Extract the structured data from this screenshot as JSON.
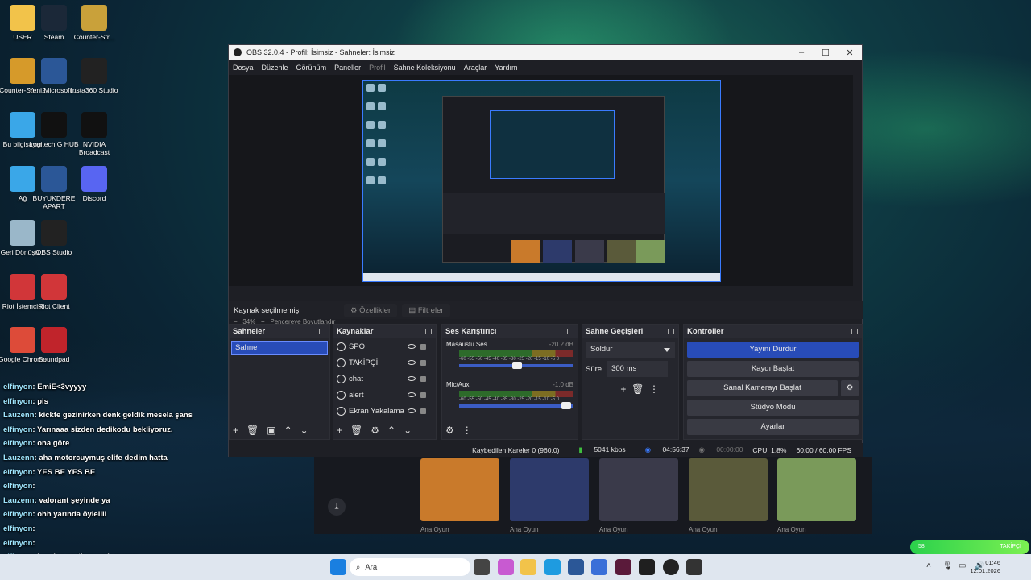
{
  "desktop_icons": [
    {
      "label": "USER",
      "icon": "folder-icon",
      "color": "#f2c34a"
    },
    {
      "label": "Steam",
      "icon": "steam-icon",
      "color": "#1b2838"
    },
    {
      "label": "Counter-Str...",
      "icon": "counter-strike-icon",
      "color": "#c9a13a"
    },
    {
      "label": "Counter-Str... 2",
      "icon": "counter-strike-icon",
      "color": "#d69a2a"
    },
    {
      "label": "Yeni Microsoft ...",
      "icon": "word-icon",
      "color": "#2b5797"
    },
    {
      "label": "Insta360 Studio",
      "icon": "insta360-icon",
      "color": "#222222"
    },
    {
      "label": "Bu bilgisayar",
      "icon": "computer-icon",
      "color": "#3aa7e8"
    },
    {
      "label": "Logitech G HUB",
      "icon": "logitech-icon",
      "color": "#111111"
    },
    {
      "label": "NVIDIA Broadcast",
      "icon": "nvidia-icon",
      "color": "#111111"
    },
    {
      "label": "Ağ",
      "icon": "network-icon",
      "color": "#3aa7e8"
    },
    {
      "label": "BUYUKDERE APART",
      "icon": "word-icon",
      "color": "#2b5797"
    },
    {
      "label": "Discord",
      "icon": "discord-icon",
      "color": "#5865f2"
    },
    {
      "label": "Geri Dönüşü...",
      "icon": "recycle-bin-icon",
      "color": "#9ab7c9"
    },
    {
      "label": "OBS Studio",
      "icon": "obs-icon",
      "color": "#222222"
    },
    {
      "label": "Riot İstemcisi",
      "icon": "riot-icon",
      "color": "#d13639"
    },
    {
      "label": "Riot Client",
      "icon": "riot-icon",
      "color": "#d13639"
    },
    {
      "label": "Google Chrome",
      "icon": "chrome-icon",
      "color": "#dd4b39"
    },
    {
      "label": "Soundpad",
      "icon": "soundpad-icon",
      "color": "#c0242b"
    }
  ],
  "chat": [
    {
      "user": "elfinyon",
      "text": ": EmiE<3vyyyy"
    },
    {
      "user": "elfinyon",
      "text": ": pis"
    },
    {
      "user": "Lauzenn",
      "text": ": kickte gezinirken denk geldik mesela şans"
    },
    {
      "user": "elfinyon",
      "text": ": Yarınaaa sizden dedikodu bekliyoruz."
    },
    {
      "user": "elfinyon",
      "text": ": ona göre"
    },
    {
      "user": "Lauzenn",
      "text": ": aha motorcuymuş elife dedim hatta"
    },
    {
      "user": "elfinyon",
      "text": ": YES BE YES BE"
    },
    {
      "user": "elfinyon",
      "text": ":"
    },
    {
      "user": "Lauzenn",
      "text": ": valorant şeyinde ya"
    },
    {
      "user": "elfinyon",
      "text": ": ohh yarında öyleiiii"
    },
    {
      "user": "elfinyon",
      "text": ":"
    },
    {
      "user": "elfinyon",
      "text": ":"
    },
    {
      "user": "elfinyon",
      "text": ": benden mutlusu yok şuanın"
    }
  ],
  "obs": {
    "title": "OBS 32.0.4 - Profil: İsimsiz - Sahneler: İsimsiz",
    "menu": [
      "Dosya",
      "Düzenle",
      "Görünüm",
      "Paneller",
      "Profil",
      "Sahne Koleksiyonu",
      "Araçlar",
      "Yardım"
    ],
    "zoom": "34%",
    "zoom_label": "Pencereye Boyutlandır",
    "source_status": "Kaynak seçilmemiş",
    "properties_label": "Özellikler",
    "filters_label": "Filtreler",
    "scenes": {
      "title": "Sahneler",
      "items": [
        "Sahne"
      ]
    },
    "sources": {
      "title": "Kaynaklar",
      "items": [
        "SPO",
        "TAKİPÇİ",
        "chat",
        "alert",
        "Ekran Yakalama"
      ]
    },
    "mixer": {
      "title": "Ses Karıştırıcı",
      "channels": [
        {
          "name": "Masaüstü Ses",
          "db": "-20.2 dB",
          "level": 0.55
        },
        {
          "name": "Mic/Aux",
          "db": "-1.0 dB",
          "level": 0.98
        }
      ],
      "ticks": "-60 -55 -50 -45 -40 -35 -30 -25 -20 -15 -10 -5 0"
    },
    "transitions": {
      "title": "Sahne Geçişleri",
      "selected": "Soldur",
      "duration_label": "Süre",
      "duration": "300 ms"
    },
    "controls": {
      "title": "Kontroller",
      "buttons": [
        "Yayını Durdur",
        "Kaydı Başlat",
        "Sanal Kamerayı Başlat",
        "Stüdyo Modu",
        "Ayarlar"
      ]
    },
    "status": {
      "dropped": "Kaybedilen Kareler 0 (960.0)",
      "bitrate": "5041 kbps",
      "stream_time": "04:56:37",
      "rec_time": "00:00:00",
      "cpu": "CPU: 1.8%",
      "fps": "60.00 / 60.00 FPS"
    }
  },
  "launcher": {
    "games": [
      {
        "label": "Ana Oyun",
        "color": "#c97a2b"
      },
      {
        "label": "Ana Oyun",
        "color": "#2d3a6b"
      },
      {
        "label": "Ana Oyun",
        "color": "#3a3a4a"
      },
      {
        "label": "Ana Oyun",
        "color": "#5a5a3a"
      },
      {
        "label": "Ana Oyun",
        "color": "#7a9a5a"
      }
    ]
  },
  "taskbar": {
    "search_placeholder": "Ara",
    "time": "01:46",
    "date": "12.01.2026"
  },
  "follow_bar": {
    "left": "58",
    "right": "TAKİPÇİ"
  }
}
